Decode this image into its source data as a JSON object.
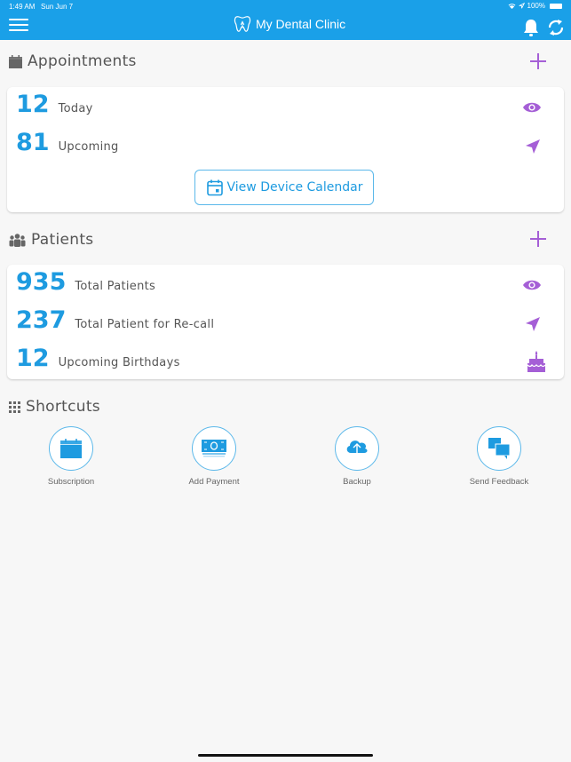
{
  "status_bar": {
    "time": "1:49 AM",
    "date": "Sun Jun 7",
    "battery": "100%"
  },
  "header": {
    "title": "My Dental Clinic"
  },
  "appointments": {
    "title": "Appointments",
    "rows": [
      {
        "value": "12",
        "label": "Today",
        "icon": "eye-icon"
      },
      {
        "value": "81",
        "label": "Upcoming",
        "icon": "send-icon"
      }
    ],
    "calendar_button": "View Device Calendar"
  },
  "patients": {
    "title": "Patients",
    "rows": [
      {
        "value": "935",
        "label": "Total Patients",
        "icon": "eye-icon"
      },
      {
        "value": "237",
        "label": "Total Patient for Re-call",
        "icon": "send-icon"
      },
      {
        "value": "12",
        "label": "Upcoming Birthdays",
        "icon": "cake-icon"
      }
    ]
  },
  "shortcuts": {
    "title": "Shortcuts",
    "items": [
      {
        "label": "Subscription",
        "icon": "calendar-icon"
      },
      {
        "label": "Add Payment",
        "icon": "money-icon"
      },
      {
        "label": "Backup",
        "icon": "cloud-upload-icon"
      },
      {
        "label": "Send Feedback",
        "icon": "chat-icon"
      }
    ]
  },
  "colors": {
    "header": "#1aa0e8",
    "accent_blue": "#1e9be0",
    "accent_purple": "#a55fd6",
    "background": "#f7f7f7"
  }
}
